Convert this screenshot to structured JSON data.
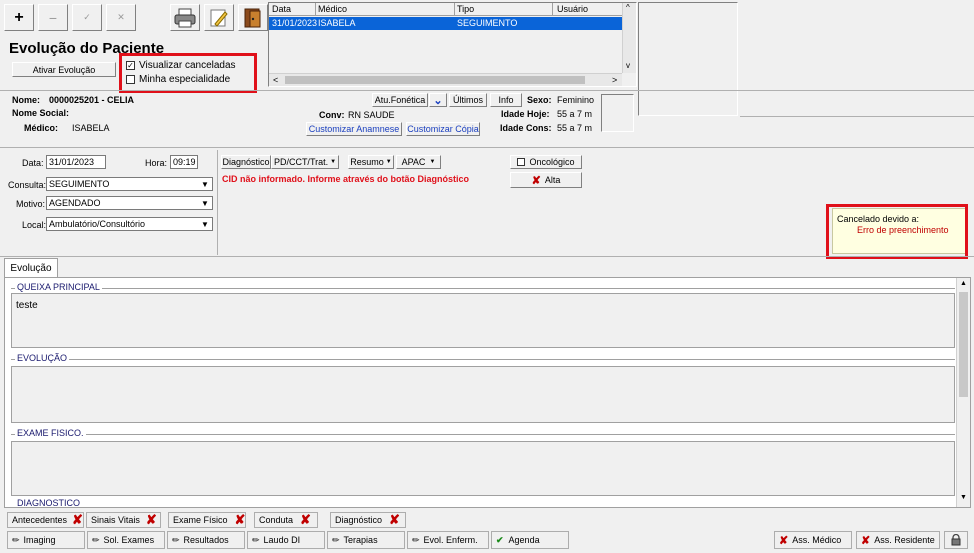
{
  "toolbar": {
    "add_label": "+",
    "remove_label": "−",
    "buttons": [
      "printer-icon",
      "pencil-icon",
      "door-icon"
    ]
  },
  "title": "Evolução do Paciente",
  "activate_button": "Ativar Evolução",
  "checks": {
    "show_cancelled": "Visualizar canceladas",
    "my_specialty": "Minha especialidade"
  },
  "grid": {
    "headers": [
      "Data",
      "Médico",
      "Tipo",
      "Usuário"
    ],
    "rows": [
      [
        "31/01/2023",
        "ISABELA",
        "SEGUIMENTO",
        ""
      ]
    ]
  },
  "patient": {
    "name_label": "Nome:",
    "name_value": "0000025201 - CELIA",
    "social_label": "Nome Social:",
    "doctor_label": "Médico:",
    "doctor_value": "ISABELA",
    "conv_label": "Conv:",
    "conv_value": "RN SAUDE",
    "sex_label": "Sexo:",
    "sex_value": "Feminino",
    "age_today_label": "Idade Hoje:",
    "age_today_value": "55 a 7 m",
    "age_cons_label": "Idade Cons:",
    "age_cons_value": "55 a 7 m",
    "btn_phonetic": "Atu.Fonética",
    "btn_last": "Últimos",
    "btn_info": "Info",
    "btn_anamnese": "Customizar Anamnese",
    "btn_copy": "Customizar Cópia"
  },
  "form": {
    "date_label": "Data:",
    "date_value": "31/01/2023",
    "time_label": "Hora:",
    "time_value": "09:19",
    "consult_label": "Consulta:",
    "consult_value": "SEGUIMENTO",
    "reason_label": "Motivo:",
    "reason_value": "AGENDADO",
    "place_label": "Local:",
    "place_value": "Ambulatório/Consultório",
    "diag_btn": "Diagnóstico",
    "pd_btn": "PD/CCT/Trat.",
    "summary_btn": "Resumo",
    "apac_btn": "APAC",
    "oncologic": "Oncológico",
    "discharge": "Alta",
    "cid_warning": "CID não informado. Informe através do botão Diagnóstico"
  },
  "cancel_box": {
    "label": "Cancelado devido a:",
    "reason": "Erro de preenchimento"
  },
  "tab": "Evolução",
  "sections": {
    "complaint_title": "QUEIXA PRINCIPAL",
    "complaint_text": "teste",
    "evolution_title": "EVOLUÇÃO",
    "exam_title": "EXAME FISICO.",
    "diag_title": "DIAGNOSTICO"
  },
  "bottom_tabs": [
    "Antecedentes",
    "Sinais Vitais",
    "Exame Físico",
    "Conduta",
    "Diagnóstico"
  ],
  "bottom_buttons": [
    "Imaging",
    "Sol. Exames",
    "Resultados",
    "Laudo DI",
    "Terapias",
    "Evol. Enferm.",
    "Agenda"
  ],
  "sign": {
    "doctor": "Ass. Médico",
    "resident": "Ass. Residente"
  },
  "colors": {
    "selection": "#0a64d8",
    "warning": "#e0101a",
    "cancel_bg": "#ffffe1"
  }
}
